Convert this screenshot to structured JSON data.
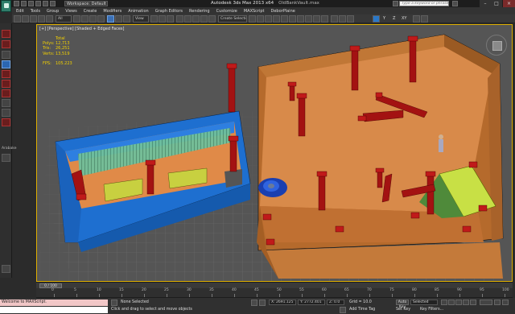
{
  "titlebar": {
    "workspace": "Workspace: Default",
    "app_title": "Autodesk 3ds Max 2013 x64",
    "file_name": "OldBankVault.max",
    "search_placeholder": "Type a keyword or phrase"
  },
  "menu": [
    "Edit",
    "Tools",
    "Group",
    "Views",
    "Create",
    "Modifiers",
    "Animation",
    "Graph Editors",
    "Rendering",
    "Customize",
    "MAXScript",
    "DeborPlaine"
  ],
  "toolbar": {
    "filter": "All",
    "view": "View",
    "selection_set": "Create Selection Se"
  },
  "left_panel": {
    "label": "Arabake"
  },
  "viewport": {
    "label": "[+] [Perspective] [Shaded + Edged Faces]",
    "stats_header": "Total",
    "stats": [
      {
        "key": "Polys:",
        "value": "12,713"
      },
      {
        "key": "Tris:",
        "value": "26,251"
      },
      {
        "key": "Verts:",
        "value": "13,519"
      }
    ],
    "fps_key": "FPS:",
    "fps_value": "105.223"
  },
  "timeline": {
    "frame": "0 / 100",
    "ticks": [
      "0",
      "5",
      "10",
      "15",
      "20",
      "25",
      "30",
      "35",
      "40",
      "45",
      "50",
      "55",
      "60",
      "65",
      "70",
      "75",
      "80",
      "85",
      "90",
      "95",
      "100"
    ]
  },
  "status": {
    "maxscript": "Welcome to MAXScript.",
    "selection": "None Selected",
    "prompt": "Click and drag to select and move objects",
    "x": "X: 2691.125",
    "y": "Y: 2772.401",
    "z": "Z: 0.0",
    "grid": "Grid = 10.0",
    "add_time_tag": "Add Time Tag",
    "auto_key": "Auto Key",
    "set_key": "Set Key",
    "selected": "Selected",
    "key_filters": "Key Filters..."
  },
  "colors": {
    "vault_blue": "#1e6fd0",
    "room_orange": "#d88a4a",
    "pillar_red": "#a31212",
    "accent_yellow": "#d0e040"
  }
}
